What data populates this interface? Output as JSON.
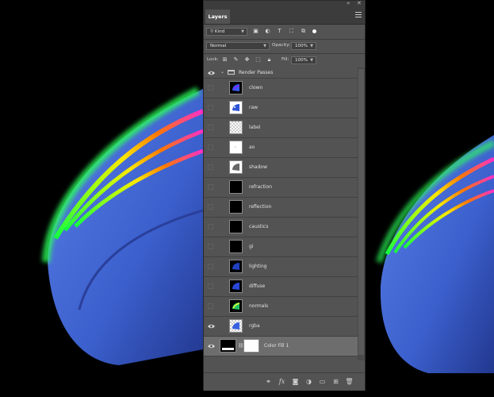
{
  "panel": {
    "tab": "Layers",
    "filter": {
      "label": "Kind"
    },
    "blend_mode": "Normal",
    "opacity": {
      "label": "Opacity:",
      "value": "100%"
    },
    "lock": {
      "label": "Lock:"
    },
    "fill": {
      "label": "Fill:",
      "value": "100%"
    }
  },
  "group": {
    "name": "Render Passes",
    "expanded": true
  },
  "layers": [
    {
      "name": "clown",
      "thumb": "clown",
      "visible": false
    },
    {
      "name": "raw",
      "thumb": "raw",
      "visible": false
    },
    {
      "name": "label",
      "thumb": "transparent",
      "visible": false
    },
    {
      "name": "ao",
      "thumb": "white",
      "visible": false
    },
    {
      "name": "shadow",
      "thumb": "shadow",
      "visible": false
    },
    {
      "name": "refraction",
      "thumb": "black",
      "visible": false
    },
    {
      "name": "reflection",
      "thumb": "black",
      "visible": false
    },
    {
      "name": "caustics",
      "thumb": "black",
      "visible": false
    },
    {
      "name": "gi",
      "thumb": "black",
      "visible": false
    },
    {
      "name": "lighting",
      "thumb": "lighting",
      "visible": false
    },
    {
      "name": "diffuse",
      "thumb": "diffuse",
      "visible": false
    },
    {
      "name": "normals",
      "thumb": "normals",
      "visible": false
    },
    {
      "name": "rgba",
      "thumb": "rgba",
      "visible": true
    },
    {
      "name": "Color Fill 1",
      "thumb": "fill",
      "visible": true,
      "selected": true
    }
  ],
  "colors": {
    "panel_bg": "#535353",
    "selected_row": "#6d6d6d",
    "canvas_bg": "#000000"
  }
}
